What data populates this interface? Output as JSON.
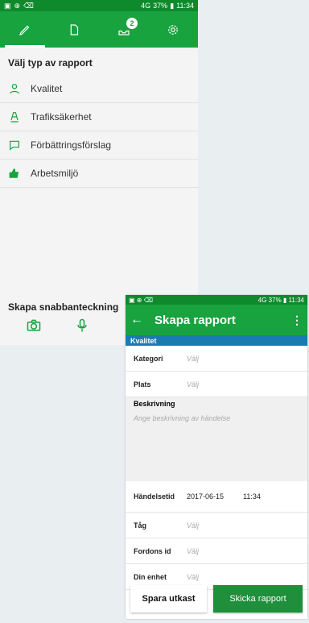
{
  "status1": {
    "left_icons": [
      "▣",
      "⊕",
      "⌫"
    ],
    "network": "4G",
    "signal": "37%",
    "time": "11:34"
  },
  "tabs": [
    {
      "icon": "pencil-icon"
    },
    {
      "icon": "document-icon"
    },
    {
      "icon": "inbox-icon",
      "badge": "2"
    },
    {
      "icon": "gear-icon"
    }
  ],
  "report_type": {
    "title": "Välj typ av rapport",
    "items": [
      {
        "label": "Kvalitet",
        "icon": "person-icon"
      },
      {
        "label": "Trafiksäkerhet",
        "icon": "train-icon"
      },
      {
        "label": "Förbättringsförslag",
        "icon": "comment-icon"
      },
      {
        "label": "Arbetsmiljö",
        "icon": "thumbs-up-icon"
      }
    ]
  },
  "quick_note": {
    "title": "Skapa snabbanteckning",
    "icons": [
      "camera-icon",
      "mic-icon"
    ]
  },
  "status2": {
    "network": "4G",
    "signal": "37%",
    "time": "11:34"
  },
  "create_report": {
    "title": "Skapa rapport",
    "back": "←",
    "more": "⋮",
    "section": "Kvalitet",
    "rows": [
      {
        "label": "Kategori",
        "value": "Välj"
      },
      {
        "label": "Plats",
        "value": "Välj"
      }
    ],
    "description_label": "Beskrivning",
    "description_placeholder": "Ange beskrivning av händelse",
    "event": {
      "label": "Händelsetid",
      "date": "2017-06-15",
      "time": "11:34"
    },
    "rows2": [
      {
        "label": "Tåg",
        "value": "Välj"
      },
      {
        "label": "Fordons id",
        "value": "Välj"
      },
      {
        "label": "Din enhet",
        "value": "Välj"
      }
    ],
    "save_label": "Spara utkast",
    "send_label": "Skicka rapport"
  },
  "colors": {
    "green": "#19a33f",
    "dark_green": "#0e8a2c",
    "blue": "#1a7bb3"
  }
}
